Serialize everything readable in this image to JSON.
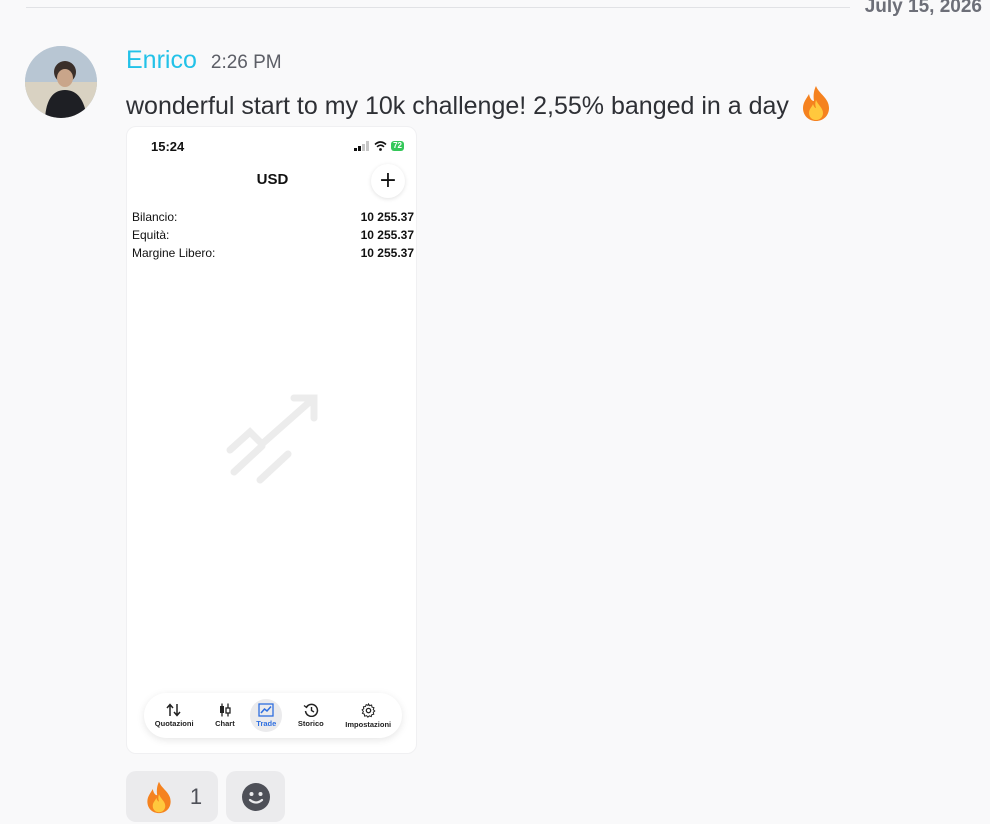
{
  "date_divider": {
    "label": "July 15, 2026"
  },
  "message": {
    "author": "Enrico",
    "time": "2:26 PM",
    "text": "wonderful start to my 10k challenge! 2,55% banged in a day",
    "emoji": "fire",
    "author_color": "#23c2e8"
  },
  "attachment": {
    "status_time": "15:24",
    "battery": "72",
    "title": "USD",
    "add_label": "+",
    "account": [
      {
        "label": "Bilancio:",
        "value": "10 255.37"
      },
      {
        "label": "Equità:",
        "value": "10 255.37"
      },
      {
        "label": "Margine Libero:",
        "value": "10 255.37"
      }
    ],
    "tabs": [
      {
        "label": "Quotazioni",
        "icon": "arrows-up-down-icon",
        "active": false
      },
      {
        "label": "Chart",
        "icon": "candlestick-icon",
        "active": false
      },
      {
        "label": "Trade",
        "icon": "trend-chart-icon",
        "active": true
      },
      {
        "label": "Storico",
        "icon": "history-clock-icon",
        "active": false
      },
      {
        "label": "Impostazioni",
        "icon": "gear-icon",
        "active": false
      }
    ],
    "accent_color": "#2f6fe0"
  },
  "reactions": [
    {
      "emoji": "fire",
      "count": "1"
    },
    {
      "emoji": "add-reaction",
      "count": ""
    }
  ]
}
